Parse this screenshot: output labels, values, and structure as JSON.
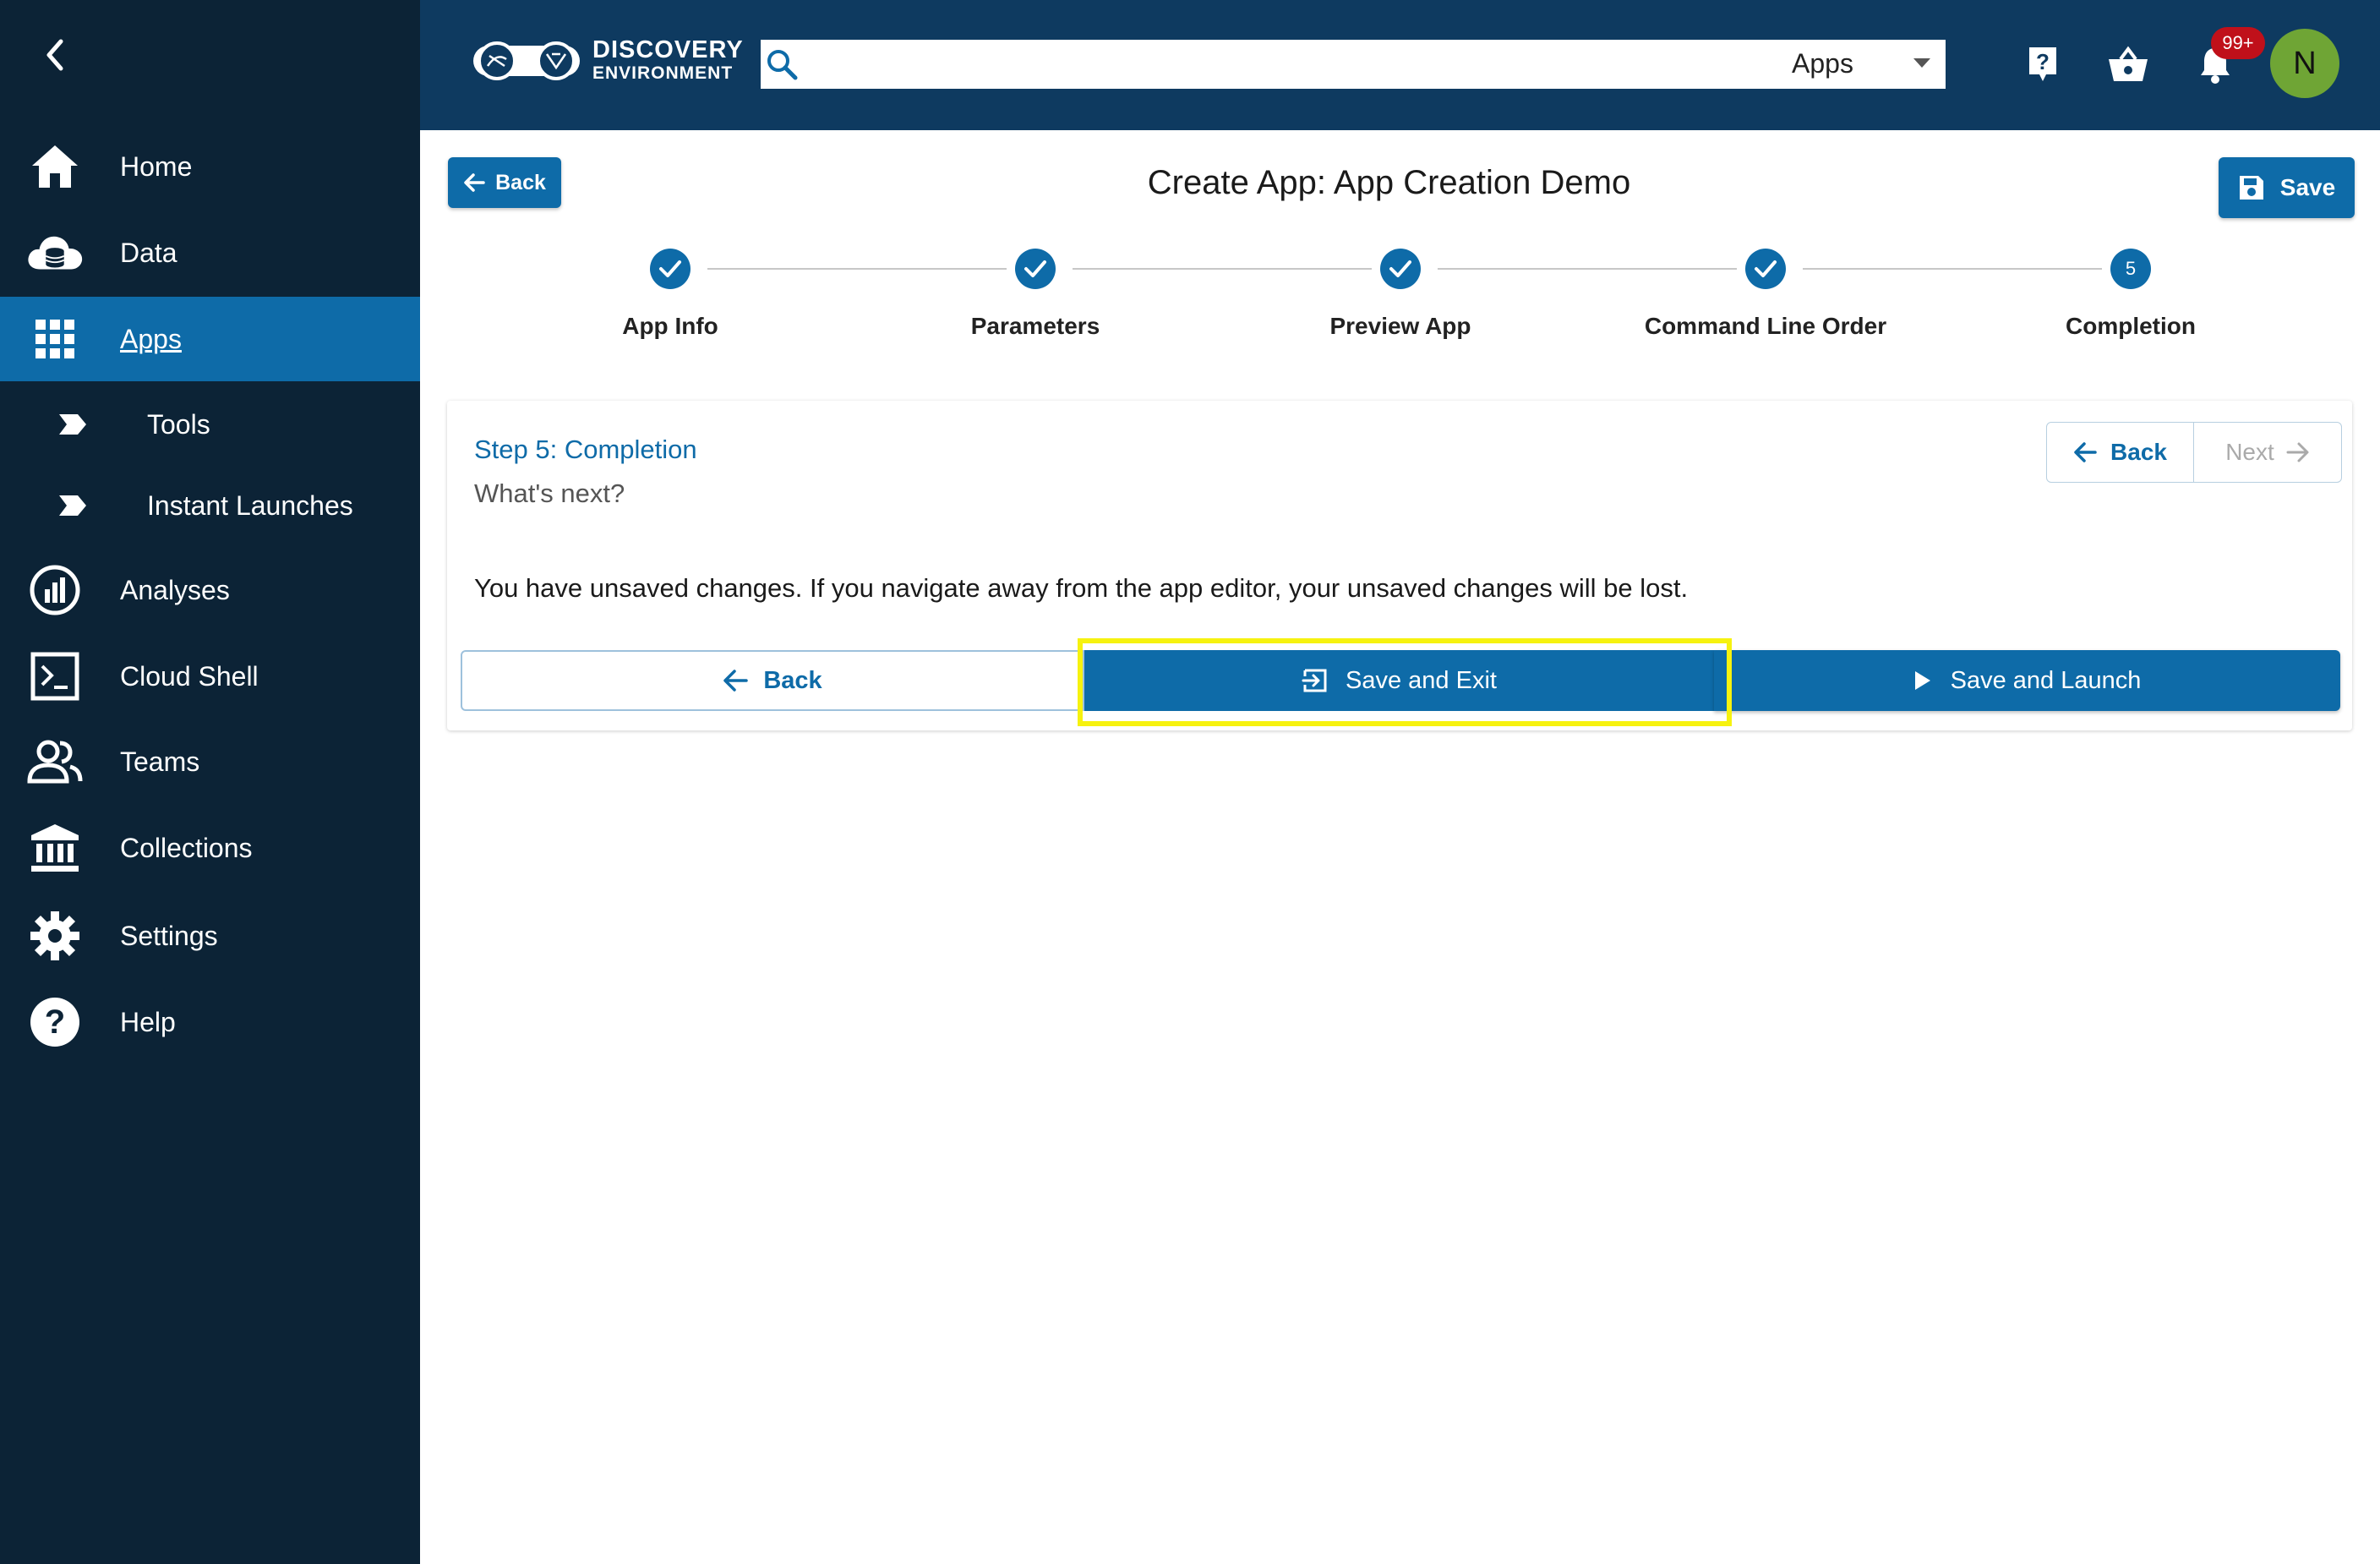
{
  "sidebar": {
    "items": [
      {
        "label": "Home",
        "icon": "home-icon"
      },
      {
        "label": "Data",
        "icon": "data-cloud-icon"
      },
      {
        "label": "Apps",
        "icon": "apps-grid-icon",
        "active": true
      },
      {
        "label": "Tools",
        "icon": "chevron-tag-icon"
      },
      {
        "label": "Instant Launches",
        "icon": "chevron-tag-icon"
      },
      {
        "label": "Analyses",
        "icon": "analyses-chart-icon"
      },
      {
        "label": "Cloud Shell",
        "icon": "terminal-icon"
      },
      {
        "label": "Teams",
        "icon": "teams-icon"
      },
      {
        "label": "Collections",
        "icon": "collections-icon"
      },
      {
        "label": "Settings",
        "icon": "gear-icon"
      },
      {
        "label": "Help",
        "icon": "help-icon"
      }
    ]
  },
  "topbar": {
    "logo_line1": "DISCOVERY",
    "logo_line2": "ENVIRONMENT",
    "search_placeholder": "",
    "search_scope": "Apps",
    "notification_count": "99+",
    "avatar_initial": "N"
  },
  "page": {
    "title": "Create App: App Creation Demo",
    "back_label": "Back",
    "save_label": "Save"
  },
  "stepper": {
    "steps": [
      {
        "label": "App Info",
        "status": "complete"
      },
      {
        "label": "Parameters",
        "status": "complete"
      },
      {
        "label": "Preview App",
        "status": "complete"
      },
      {
        "label": "Command Line Order",
        "status": "complete"
      },
      {
        "label": "Completion",
        "status": "active",
        "number": "5"
      }
    ]
  },
  "card": {
    "heading": "Step 5: Completion",
    "subheading": "What's next?",
    "nav_back": "Back",
    "nav_next": "Next",
    "message": "You have unsaved changes. If you navigate away from the app editor, your unsaved changes will be lost.",
    "action_back": "Back",
    "action_save_exit": "Save and Exit",
    "action_save_launch": "Save and Launch"
  },
  "colors": {
    "sidebar_bg": "#0c2336",
    "topbar_bg": "#0e3a60",
    "primary": "#0e6ba8",
    "highlight": "#f6f20f",
    "badge": "#c0101a",
    "avatar": "#6fa535"
  }
}
